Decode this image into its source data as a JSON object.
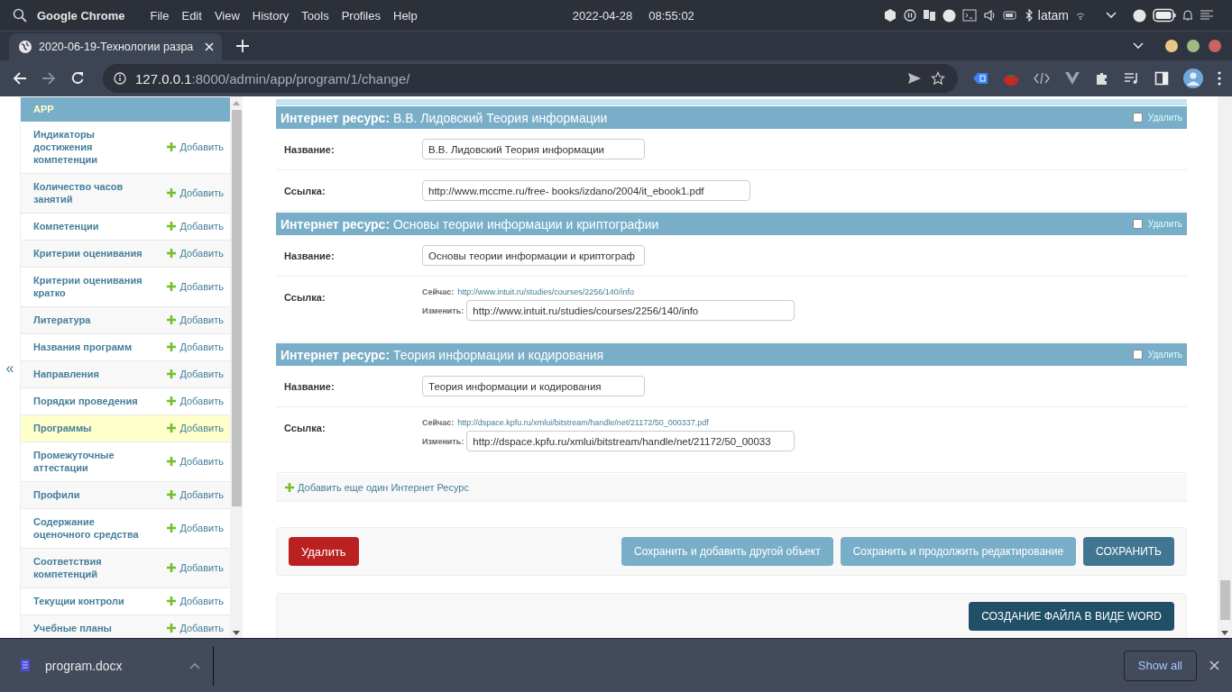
{
  "os_bar": {
    "app": "Google Chrome",
    "menus": [
      "File",
      "Edit",
      "View",
      "History",
      "Tools",
      "Profiles",
      "Help"
    ],
    "date": "2022-04-28",
    "time": "08:55:02",
    "keyboard": "latam"
  },
  "browser": {
    "tabs": [
      {
        "title": "2020-06-19-Технологии разра",
        "selected": true
      }
    ],
    "url": {
      "host": "127.0.0.1",
      "path": ":8000/admin/app/program/1/change/"
    }
  },
  "collapse_toggle": "«",
  "sidebar": {
    "header": "APP",
    "items": [
      {
        "label": "Индикаторы достижения компетенции",
        "add": "Добавить",
        "selected": false
      },
      {
        "label": "Количество часов занятий",
        "add": "Добавить",
        "selected": false
      },
      {
        "label": "Компетенции",
        "add": "Добавить",
        "selected": false
      },
      {
        "label": "Критерии оценивания",
        "add": "Добавить",
        "selected": false
      },
      {
        "label": "Критерии оценивания кратко",
        "add": "Добавить",
        "selected": false
      },
      {
        "label": "Литература",
        "add": "Добавить",
        "selected": false
      },
      {
        "label": "Названия программ",
        "add": "Добавить",
        "selected": false
      },
      {
        "label": "Направления",
        "add": "Добавить",
        "selected": false
      },
      {
        "label": "Порядки проведения",
        "add": "Добавить",
        "selected": false
      },
      {
        "label": "Программы",
        "add": "Добавить",
        "selected": true
      },
      {
        "label": "Промежуточные аттестации",
        "add": "Добавить",
        "selected": false
      },
      {
        "label": "Профили",
        "add": "Добавить",
        "selected": false
      },
      {
        "label": "Содержание оценочного средства",
        "add": "Добавить",
        "selected": false
      },
      {
        "label": "Соответствия компетенций",
        "add": "Добавить",
        "selected": false
      },
      {
        "label": "Текущии контроли",
        "add": "Добавить",
        "selected": false
      },
      {
        "label": "Учебные планы",
        "add": "Добавить",
        "selected": false
      }
    ]
  },
  "inlines": [
    {
      "prefix": "Интернет ресурс:",
      "title": "В.В. Лидовский Теория информации",
      "delete_label": "Удалить",
      "delete_checked": false,
      "fields": [
        {
          "kind": "text",
          "label": "Название:",
          "value": "В.В. Лидовский Теория информации"
        },
        {
          "kind": "url",
          "label": "Ссылка:",
          "value": "http://www.mccme.ru/free- books/izdano/2004/it_ebook1.pdf"
        }
      ]
    },
    {
      "prefix": "Интернет ресурс:",
      "title": "Основы теории информации и криптографии",
      "delete_label": "Удалить",
      "delete_checked": false,
      "fields": [
        {
          "kind": "text",
          "label": "Название:",
          "value": "Основы теории информации и криптограф"
        },
        {
          "kind": "file",
          "label": "Ссылка:",
          "current_label": "Сейчас:",
          "current": "http://www.intuit.ru/studies/courses/2256/140/info",
          "change_label": "Изменить:",
          "value": "http://www.intuit.ru/studies/courses/2256/140/info"
        }
      ]
    },
    {
      "prefix": "Интернет ресурс:",
      "title": "Теория информации и кодирования",
      "delete_label": "Удалить",
      "delete_checked": false,
      "fields": [
        {
          "kind": "text",
          "label": "Название:",
          "value": "Теория информации и кодирования"
        },
        {
          "kind": "file",
          "label": "Ссылка:",
          "current_label": "Сейчас:",
          "current": "http://dspace.kpfu.ru/xmlui/bitstream/handle/net/21172/50_000337.pdf",
          "change_label": "Изменить:",
          "value": "http://dspace.kpfu.ru/xmlui/bitstream/handle/net/21172/50_00033"
        }
      ]
    }
  ],
  "add_another": "Добавить еще один Интернет Ресурс",
  "submit_row": {
    "delete": "Удалить",
    "buttons": [
      {
        "kind": "secondary",
        "label": "Сохранить и добавить другой объект"
      },
      {
        "kind": "secondary",
        "label": "Сохранить и продолжить редактирование"
      },
      {
        "kind": "primary",
        "label": "СОХРАНИТЬ"
      }
    ]
  },
  "word_button": "СОЗДАНИЕ ФАЙЛА В ВИДЕ WORD",
  "download_bar": {
    "file": "program.docx",
    "show_all": "Show all"
  }
}
